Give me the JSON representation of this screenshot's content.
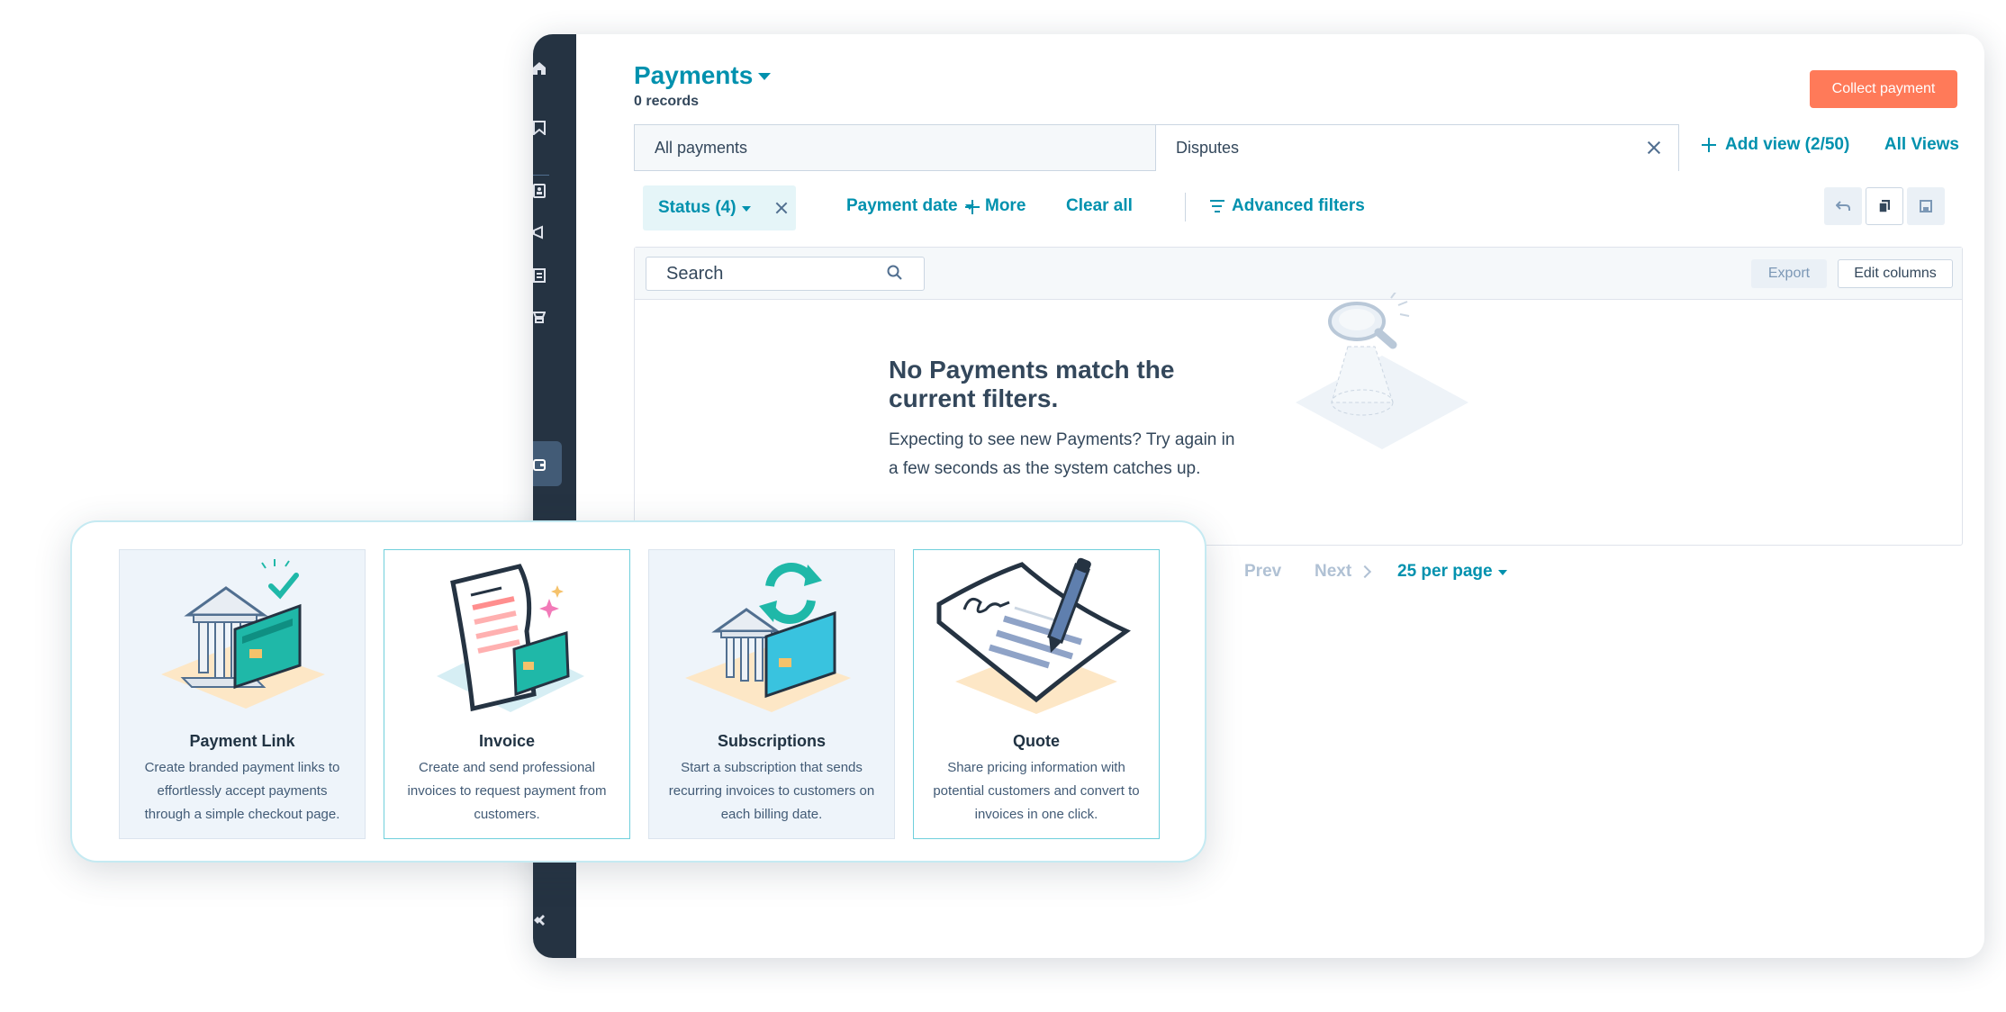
{
  "header": {
    "title": "Payments",
    "record_count": "0 records",
    "collect_button": "Collect payment"
  },
  "tabs": [
    {
      "label": "All payments",
      "active": false
    },
    {
      "label": "Disputes",
      "active": true
    }
  ],
  "views": {
    "add_view": "Add view (2/50)",
    "all_views": "All Views"
  },
  "filters": {
    "status": "Status (4)",
    "payment_date": "Payment date",
    "more": "More",
    "clear_all": "Clear all",
    "advanced": "Advanced filters"
  },
  "table": {
    "search_placeholder": "Search",
    "export": "Export",
    "edit_columns": "Edit columns",
    "empty_title": "No Payments match the current filters.",
    "empty_body": "Expecting to see new Payments? Try again in a few seconds as the system catches up."
  },
  "pagination": {
    "prev": "Prev",
    "next": "Next",
    "per_page": "25 per page"
  },
  "cards": [
    {
      "title": "Payment Link",
      "desc": "Create branded payment links to effortlessly accept payments through a simple checkout page.",
      "icon": "bank-card-icon"
    },
    {
      "title": "Invoice",
      "desc": "Create and send professional invoices to request payment from customers.",
      "icon": "invoice-document-icon"
    },
    {
      "title": "Subscriptions",
      "desc": "Start a subscription that sends recurring invoices to customers on each billing date.",
      "icon": "recurring-bank-icon"
    },
    {
      "title": "Quote",
      "desc": "Share pricing information with potential customers and convert to invoices in one click.",
      "icon": "signed-quote-icon"
    }
  ],
  "colors": {
    "brand_teal": "#0091ae",
    "accent_orange": "#ff7a59",
    "sidebar": "#253342",
    "text": "#33475b"
  }
}
